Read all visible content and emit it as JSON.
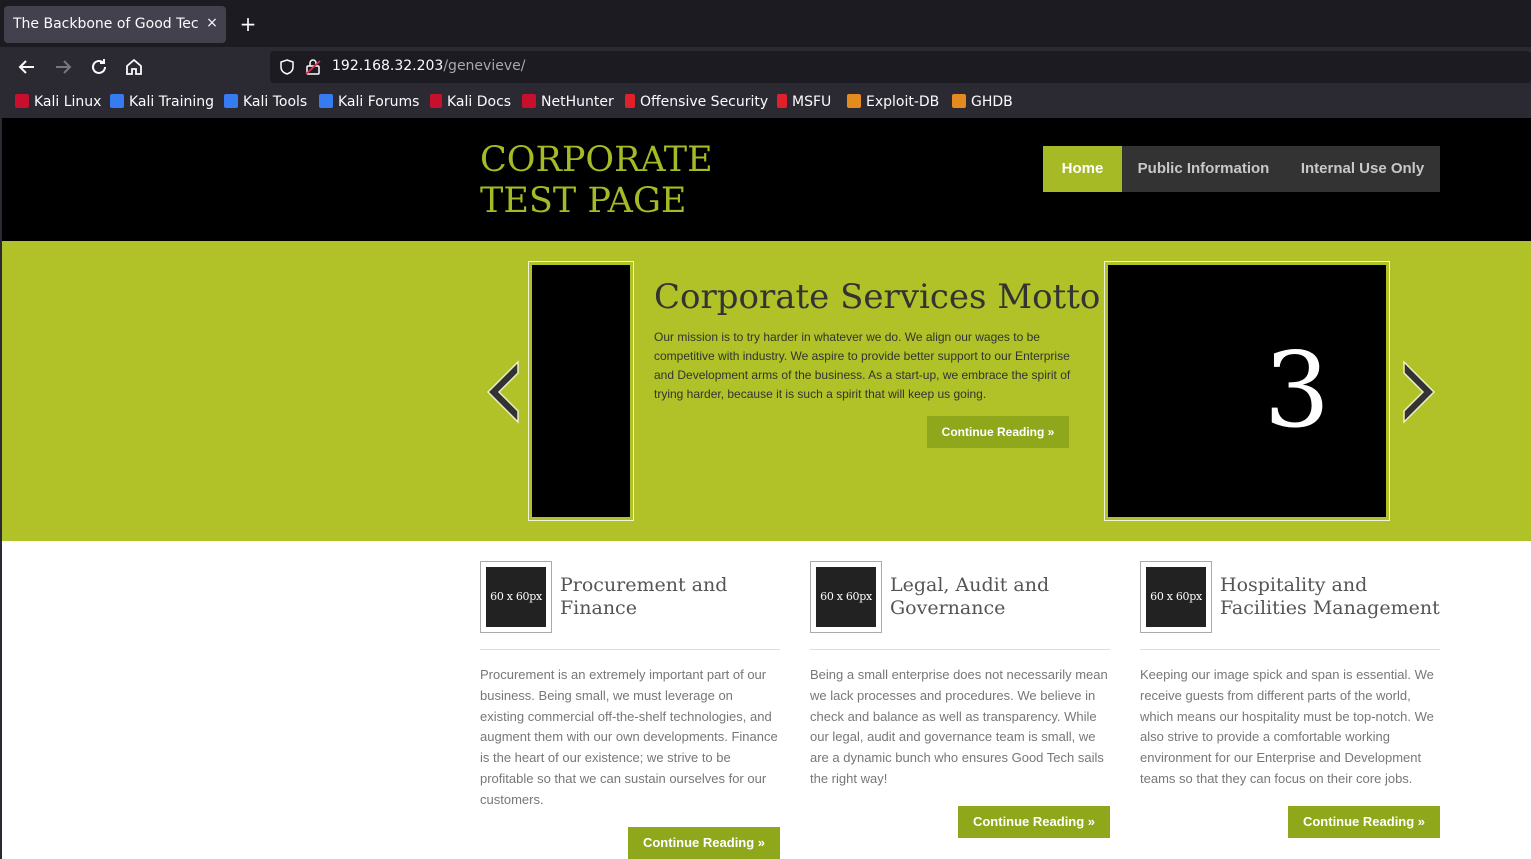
{
  "browser": {
    "tab_title": "The Backbone of Good Tech",
    "tab_close": "×",
    "new_tab": "+",
    "url_host": "192.168.32.203",
    "url_path": "/genevieve/",
    "bookmarks": [
      {
        "label": "Kali Linux",
        "icon": "kali-icon"
      },
      {
        "label": "Kali Training",
        "icon": "kali-training-icon"
      },
      {
        "label": "Kali Tools",
        "icon": "kali-tools-icon"
      },
      {
        "label": "Kali Forums",
        "icon": "kali-forums-icon"
      },
      {
        "label": "Kali Docs",
        "icon": "kali-docs-icon"
      },
      {
        "label": "NetHunter",
        "icon": "nethunter-icon"
      },
      {
        "label": "Offensive Security",
        "icon": "offsec-icon"
      },
      {
        "label": "MSFU",
        "icon": "msfu-icon"
      },
      {
        "label": "Exploit-DB",
        "icon": "exploitdb-icon"
      },
      {
        "label": "GHDB",
        "icon": "ghdb-icon"
      }
    ]
  },
  "site": {
    "logo_line1": "CORPORATE",
    "logo_line2": "TEST PAGE",
    "nav": [
      "Home",
      "Public Information",
      "Internal Use Only"
    ],
    "active_nav": "Home"
  },
  "hero": {
    "title": "Corporate Services Motto",
    "text": "Our mission is to try harder in whatever we do. We align our wages to be competitive with industry. We aspire to provide better support to our Enterprise and Development arms of the business. As a start-up, we embrace the spirit of trying harder, because it is such a spirit that will keep us going.",
    "button": "Continue Reading »",
    "slide_number": "3"
  },
  "columns": [
    {
      "thumb": "60 x 60px",
      "title": "Procurement and Finance",
      "text": "Procurement is an extremely important part of our business. Being small, we must leverage on existing commercial off-the-shelf technologies, and augment them with our own developments. Finance is the heart of our existence; we strive to be profitable so that we can sustain ourselves for our customers.",
      "button": "Continue Reading »"
    },
    {
      "thumb": "60 x 60px",
      "title": "Legal, Audit and Governance",
      "text": "Being a small enterprise does not necessarily mean we lack processes and procedures. We believe in check and balance as well as transparency. While our legal, audit and governance team is small, we are a dynamic bunch who ensures Good Tech sails the right way!",
      "button": "Continue Reading »"
    },
    {
      "thumb": "60 x 60px",
      "title": "Hospitality and Facilities Management",
      "text": "Keeping our image spick and span is essential. We receive guests from different parts of the world, which means our hospitality must be top-notch. We also strive to provide a comfortable working environment for our Enterprise and Development teams so that they can focus on their core jobs.",
      "button": "Continue Reading »"
    }
  ],
  "colors": {
    "accent": "#a5ba25",
    "hero_bg": "#b0c227",
    "button": "#8ea71b",
    "header_bg": "#000000"
  }
}
